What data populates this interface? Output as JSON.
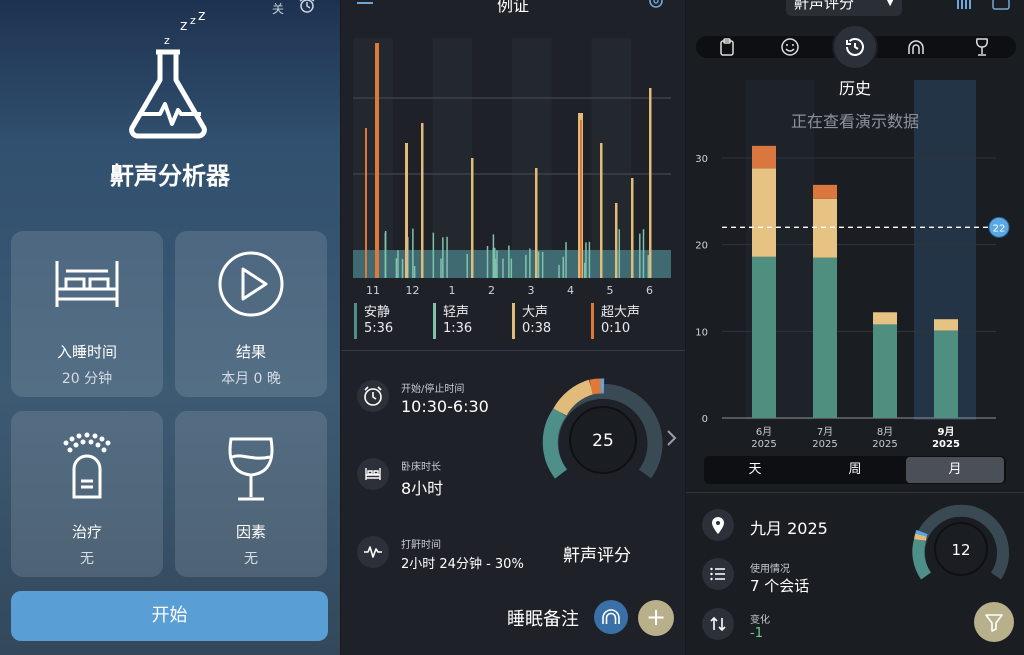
{
  "p1": {
    "top_right_text": "关",
    "title": "鼾声分析器",
    "tiles": [
      {
        "title": "入睡时间",
        "sub": "20 分钟"
      },
      {
        "title": "结果",
        "sub": "本月 0 晚"
      },
      {
        "title": "治疗",
        "sub": "无"
      },
      {
        "title": "因素",
        "sub": "无"
      }
    ],
    "start": "开始"
  },
  "p2": {
    "title": "例证",
    "xticks": [
      "11",
      "12",
      "1",
      "2",
      "3",
      "4",
      "5",
      "6"
    ],
    "legend": [
      {
        "label": "安静",
        "value": "5:36",
        "color": "#4e8f8a"
      },
      {
        "label": "轻声",
        "value": "1:36",
        "color": "#7fc2ad"
      },
      {
        "label": "大声",
        "value": "0:38",
        "color": "#e0bb7a"
      },
      {
        "label": "超大声",
        "value": "0:10",
        "color": "#e0783a"
      }
    ],
    "stats": [
      {
        "label": "开始/停止时间",
        "value": "10:30-6:30"
      },
      {
        "label": "卧床时长",
        "value": "8小时"
      },
      {
        "label": "打鼾时间",
        "value": "2小时 24分钟 - 30%"
      }
    ],
    "score": "25",
    "score_label": "鼾声评分",
    "notes_label": "睡眠备注",
    "plus": "+"
  },
  "p3": {
    "dropdown": "鼾声评分",
    "section_title": "历史",
    "demo_text": "正在查看演示数据",
    "average_badge": "22",
    "segments": [
      "天",
      "周",
      "月"
    ],
    "selected_segment": "月",
    "location": "九月 2025",
    "usage_label": "使用情况",
    "usage_value": "7 个会话",
    "change_label": "变化",
    "change_value": "-1",
    "gauge_value": "12"
  },
  "chart_data": {
    "type": "bar",
    "stacked": true,
    "categories": [
      "6月\n2025",
      "7月\n2025",
      "8月\n2025",
      "9月\n2025"
    ],
    "category_labels": [
      [
        "6月",
        "2025"
      ],
      [
        "7月",
        "2025"
      ],
      [
        "8月",
        "2025"
      ],
      [
        "9月",
        "2025"
      ]
    ],
    "series": [
      {
        "color": "#4e8f80",
        "values": [
          18.6,
          18.5,
          10.8,
          10.1
        ]
      },
      {
        "color": "#e6c283",
        "values": [
          10.2,
          6.8,
          1.4,
          1.3
        ]
      },
      {
        "color": "#d9773f",
        "values": [
          2.6,
          1.6,
          0,
          0
        ]
      }
    ],
    "yticks": [
      "0",
      "10",
      "20",
      "30"
    ],
    "ylim": [
      0,
      33
    ],
    "reference_line": 22,
    "grid": true
  }
}
